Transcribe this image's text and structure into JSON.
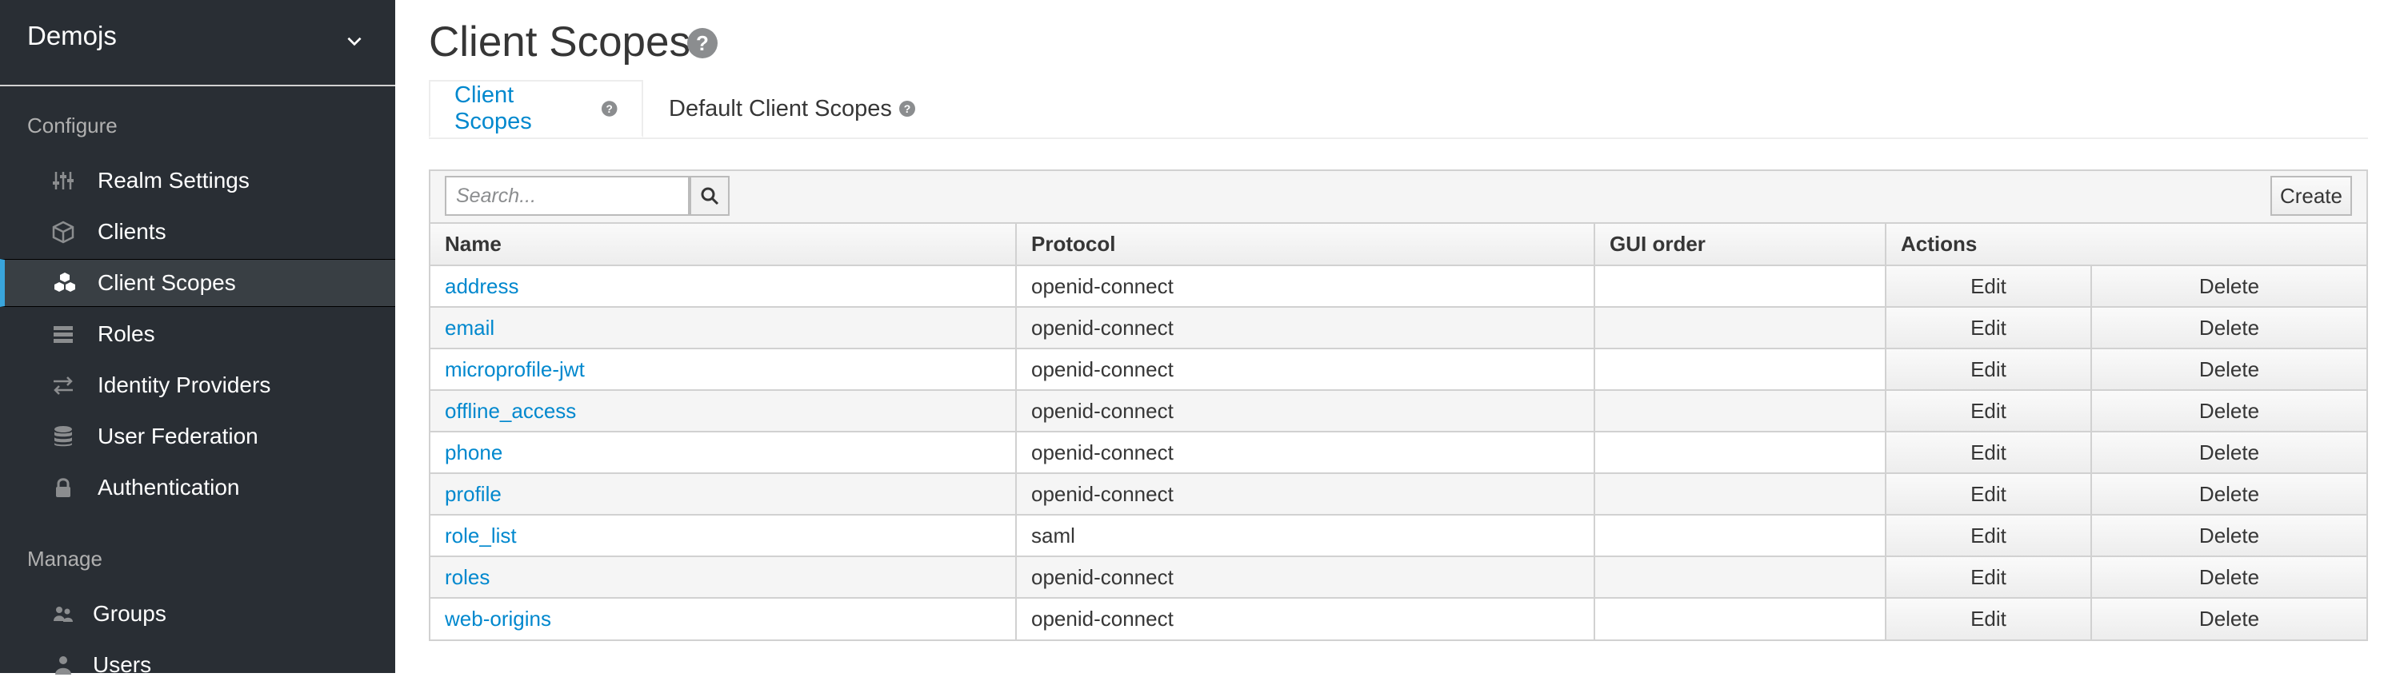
{
  "sidebar": {
    "realm": "Demojs",
    "configure_title": "Configure",
    "manage_title": "Manage",
    "configure_items": [
      {
        "label": "Realm Settings",
        "icon": "sliders-icon"
      },
      {
        "label": "Clients",
        "icon": "cube-icon"
      },
      {
        "label": "Client Scopes",
        "icon": "cubes-icon",
        "active": true
      },
      {
        "label": "Roles",
        "icon": "list-icon"
      },
      {
        "label": "Identity Providers",
        "icon": "exchange-icon"
      },
      {
        "label": "User Federation",
        "icon": "database-icon"
      },
      {
        "label": "Authentication",
        "icon": "lock-icon"
      }
    ],
    "manage_items": [
      {
        "label": "Groups",
        "icon": "users-icon"
      },
      {
        "label": "Users",
        "icon": "user-icon"
      }
    ]
  },
  "page": {
    "title": "Client Scopes",
    "tabs": [
      {
        "label": "Client Scopes",
        "active": true
      },
      {
        "label": "Default Client Scopes",
        "active": false
      }
    ]
  },
  "toolbar": {
    "search_placeholder": "Search...",
    "create_label": "Create"
  },
  "table": {
    "columns": [
      "Name",
      "Protocol",
      "GUI order",
      "Actions"
    ],
    "edit_label": "Edit",
    "delete_label": "Delete",
    "rows": [
      {
        "name": "address",
        "protocol": "openid-connect",
        "gui_order": ""
      },
      {
        "name": "email",
        "protocol": "openid-connect",
        "gui_order": ""
      },
      {
        "name": "microprofile-jwt",
        "protocol": "openid-connect",
        "gui_order": ""
      },
      {
        "name": "offline_access",
        "protocol": "openid-connect",
        "gui_order": ""
      },
      {
        "name": "phone",
        "protocol": "openid-connect",
        "gui_order": ""
      },
      {
        "name": "profile",
        "protocol": "openid-connect",
        "gui_order": ""
      },
      {
        "name": "role_list",
        "protocol": "saml",
        "gui_order": ""
      },
      {
        "name": "roles",
        "protocol": "openid-connect",
        "gui_order": ""
      },
      {
        "name": "web-origins",
        "protocol": "openid-connect",
        "gui_order": ""
      }
    ]
  },
  "colors": {
    "sidebar_bg": "#292e34",
    "active_accent": "#39a5dc",
    "link": "#0088ce"
  }
}
